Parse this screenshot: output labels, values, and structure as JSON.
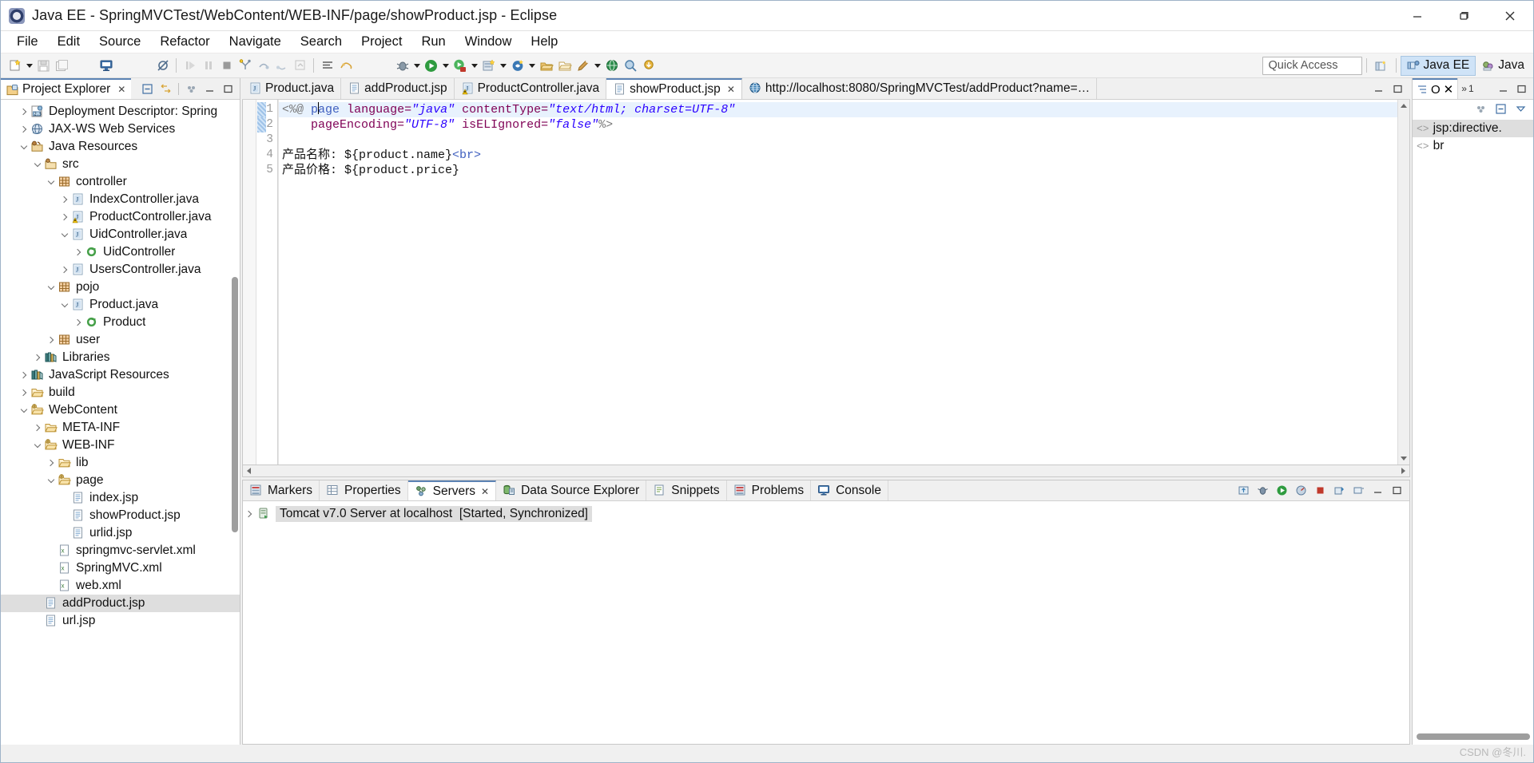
{
  "window": {
    "title": "Java EE - SpringMVCTest/WebContent/WEB-INF/page/showProduct.jsp - Eclipse",
    "app_icon": "eclipse-icon",
    "minimize": "minimize-icon",
    "maximize": "maximize-icon",
    "close": "close-icon"
  },
  "menubar": {
    "items": [
      "File",
      "Edit",
      "Source",
      "Refactor",
      "Navigate",
      "Search",
      "Project",
      "Run",
      "Window",
      "Help"
    ]
  },
  "toolbar": {
    "quick_access_placeholder": "Quick Access",
    "perspectives": [
      {
        "label": "Java EE",
        "active": true
      },
      {
        "label": "Java",
        "active": false
      }
    ]
  },
  "project_explorer": {
    "tab_label": "Project Explorer",
    "tree": [
      {
        "label": "Deployment Descriptor: Spring",
        "indent": 1,
        "arrow": "collapsed",
        "icon": "deployment-descriptor-icon"
      },
      {
        "label": "JAX-WS Web Services",
        "indent": 1,
        "arrow": "collapsed",
        "icon": "jaxws-icon"
      },
      {
        "label": "Java Resources",
        "indent": 1,
        "arrow": "expanded",
        "icon": "java-resources-icon"
      },
      {
        "label": "src",
        "indent": 2,
        "arrow": "expanded",
        "icon": "source-folder-icon"
      },
      {
        "label": "controller",
        "indent": 3,
        "arrow": "expanded",
        "icon": "package-icon"
      },
      {
        "label": "IndexController.java",
        "indent": 4,
        "arrow": "collapsed",
        "icon": "java-file-icon"
      },
      {
        "label": "ProductController.java",
        "indent": 4,
        "arrow": "collapsed",
        "icon": "java-file-warning-icon"
      },
      {
        "label": "UidController.java",
        "indent": 4,
        "arrow": "expanded",
        "icon": "java-file-icon"
      },
      {
        "label": "UidController",
        "indent": 5,
        "arrow": "collapsed",
        "icon": "class-icon"
      },
      {
        "label": "UsersController.java",
        "indent": 4,
        "arrow": "collapsed",
        "icon": "java-file-icon"
      },
      {
        "label": "pojo",
        "indent": 3,
        "arrow": "expanded",
        "icon": "package-icon"
      },
      {
        "label": "Product.java",
        "indent": 4,
        "arrow": "expanded",
        "icon": "java-file-icon"
      },
      {
        "label": "Product",
        "indent": 5,
        "arrow": "collapsed",
        "icon": "class-icon"
      },
      {
        "label": "user",
        "indent": 3,
        "arrow": "collapsed",
        "icon": "package-icon"
      },
      {
        "label": "Libraries",
        "indent": 2,
        "arrow": "collapsed",
        "icon": "library-icon"
      },
      {
        "label": "JavaScript Resources",
        "indent": 1,
        "arrow": "collapsed",
        "icon": "library-icon"
      },
      {
        "label": "build",
        "indent": 1,
        "arrow": "collapsed",
        "icon": "folder-icon"
      },
      {
        "label": "WebContent",
        "indent": 1,
        "arrow": "expanded",
        "icon": "web-folder-icon"
      },
      {
        "label": "META-INF",
        "indent": 2,
        "arrow": "collapsed",
        "icon": "folder-icon"
      },
      {
        "label": "WEB-INF",
        "indent": 2,
        "arrow": "expanded",
        "icon": "web-folder-icon"
      },
      {
        "label": "lib",
        "indent": 3,
        "arrow": "collapsed",
        "icon": "folder-icon"
      },
      {
        "label": "page",
        "indent": 3,
        "arrow": "expanded",
        "icon": "web-folder-icon"
      },
      {
        "label": "index.jsp",
        "indent": 4,
        "arrow": "none",
        "icon": "jsp-file-icon"
      },
      {
        "label": "showProduct.jsp",
        "indent": 4,
        "arrow": "none",
        "icon": "jsp-file-icon"
      },
      {
        "label": "urlid.jsp",
        "indent": 4,
        "arrow": "none",
        "icon": "jsp-file-icon"
      },
      {
        "label": "springmvc-servlet.xml",
        "indent": 3,
        "arrow": "none",
        "icon": "xml-file-icon"
      },
      {
        "label": "SpringMVC.xml",
        "indent": 3,
        "arrow": "none",
        "icon": "xml-file-icon"
      },
      {
        "label": "web.xml",
        "indent": 3,
        "arrow": "none",
        "icon": "xml-file-icon"
      },
      {
        "label": "addProduct.jsp",
        "indent": 2,
        "arrow": "none",
        "icon": "jsp-file-icon",
        "selected": true
      },
      {
        "label": "url.jsp",
        "indent": 2,
        "arrow": "none",
        "icon": "jsp-file-icon"
      }
    ]
  },
  "editor": {
    "tabs": [
      {
        "label": "Product.java",
        "icon": "java-file-icon",
        "active": false,
        "closable": false
      },
      {
        "label": "addProduct.jsp",
        "icon": "jsp-file-icon",
        "active": false,
        "closable": false
      },
      {
        "label": "ProductController.java",
        "icon": "java-file-warning-icon",
        "active": false,
        "closable": false
      },
      {
        "label": "showProduct.jsp",
        "icon": "jsp-file-icon",
        "active": true,
        "closable": true
      },
      {
        "label": "http://localhost:8080/SpringMVCTest/addProduct?name=…",
        "icon": "browser-icon",
        "active": false,
        "closable": false
      }
    ],
    "line_numbers": [
      "1",
      "2",
      "3",
      "4",
      "5"
    ],
    "lines": [
      {
        "n": "1",
        "current": true,
        "tokens": [
          {
            "t": "<%@",
            "c": "k-dir"
          },
          {
            "t": " ",
            "c": "k-plain"
          },
          {
            "t": "p",
            "c": "k-tagname"
          },
          {
            "t": "CARET",
            "c": "caret"
          },
          {
            "t": "age",
            "c": "k-tagname"
          },
          {
            "t": " ",
            "c": "k-plain"
          },
          {
            "t": "language=",
            "c": "k-attr"
          },
          {
            "t": "\"java\"",
            "c": "k-val"
          },
          {
            "t": " ",
            "c": "k-plain"
          },
          {
            "t": "contentType=",
            "c": "k-attr"
          },
          {
            "t": "\"text/html; charset=UTF-8\"",
            "c": "k-val"
          }
        ]
      },
      {
        "n": "2",
        "current": false,
        "tokens": [
          {
            "t": "    ",
            "c": "k-plain"
          },
          {
            "t": "pageEncoding=",
            "c": "k-attr"
          },
          {
            "t": "\"UTF-8\"",
            "c": "k-val"
          },
          {
            "t": " ",
            "c": "k-plain"
          },
          {
            "t": "isELIgnored=",
            "c": "k-attr"
          },
          {
            "t": "\"false\"",
            "c": "k-val"
          },
          {
            "t": "%>",
            "c": "k-dir"
          }
        ]
      },
      {
        "n": "3",
        "current": false,
        "tokens": []
      },
      {
        "n": "4",
        "current": false,
        "tokens": [
          {
            "t": "产品名称: ${product.name}",
            "c": "k-plain"
          },
          {
            "t": "<br>",
            "c": "k-tagname"
          }
        ]
      },
      {
        "n": "5",
        "current": false,
        "tokens": [
          {
            "t": "产品价格: ${product.price}",
            "c": "k-plain"
          }
        ]
      }
    ]
  },
  "outline": {
    "tab_label": "O",
    "minimized_tab_label": "1",
    "items": [
      {
        "label": "jsp:directive.",
        "selected": true,
        "icon": "element-icon"
      },
      {
        "label": "br",
        "selected": false,
        "icon": "element-icon"
      }
    ]
  },
  "bottom_panel": {
    "tabs": [
      {
        "label": "Markers",
        "icon": "markers-icon",
        "active": false,
        "closable": false
      },
      {
        "label": "Properties",
        "icon": "properties-icon",
        "active": false,
        "closable": false
      },
      {
        "label": "Servers",
        "icon": "servers-icon",
        "active": true,
        "closable": true
      },
      {
        "label": "Data Source Explorer",
        "icon": "datasource-icon",
        "active": false,
        "closable": false
      },
      {
        "label": "Snippets",
        "icon": "snippets-icon",
        "active": false,
        "closable": false
      },
      {
        "label": "Problems",
        "icon": "problems-icon",
        "active": false,
        "closable": false
      },
      {
        "label": "Console",
        "icon": "console-icon",
        "active": false,
        "closable": false
      }
    ],
    "server_row": {
      "name": "Tomcat v7.0 Server at localhost",
      "status": "[Started, Synchronized]",
      "icon": "server-icon"
    }
  },
  "watermark": "CSDN @冬川."
}
